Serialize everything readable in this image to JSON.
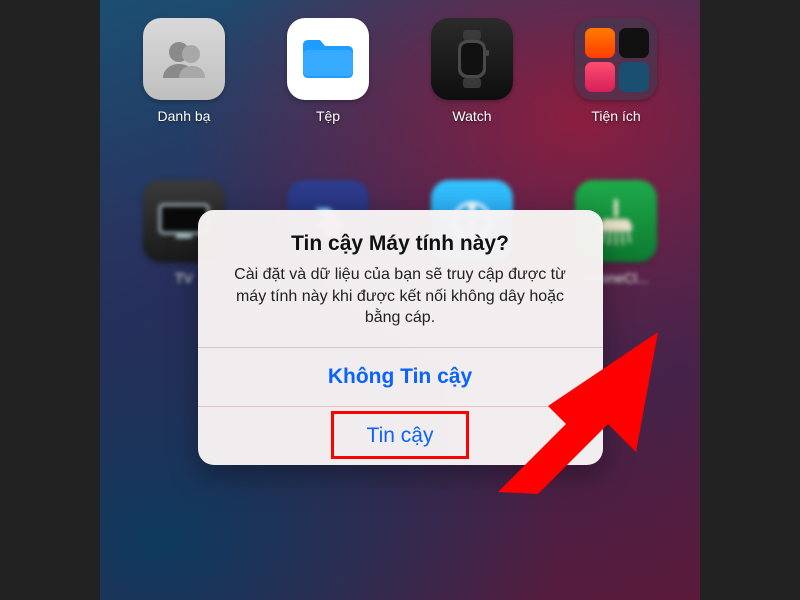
{
  "apps_row1": [
    {
      "name": "contacts",
      "label": "Danh bạ"
    },
    {
      "name": "files",
      "label": "Tệp"
    },
    {
      "name": "watch",
      "label": "Watch"
    },
    {
      "name": "utilities",
      "label": "Tiện ích"
    }
  ],
  "apps_row2": [
    {
      "name": "tv",
      "label": "TV"
    },
    {
      "name": "shortcuts",
      "label": ""
    },
    {
      "name": "itunes",
      "label": ""
    },
    {
      "name": "phoneclean",
      "label": "PhoneCl..."
    }
  ],
  "alert": {
    "title": "Tin cậy Máy tính này?",
    "message": "Cài đặt và dữ liệu của bạn sẽ truy cập được từ máy tính này khi được kết nối không dây hoặc bằng cáp.",
    "dont_trust": "Không Tin cậy",
    "trust": "Tin cậy"
  }
}
